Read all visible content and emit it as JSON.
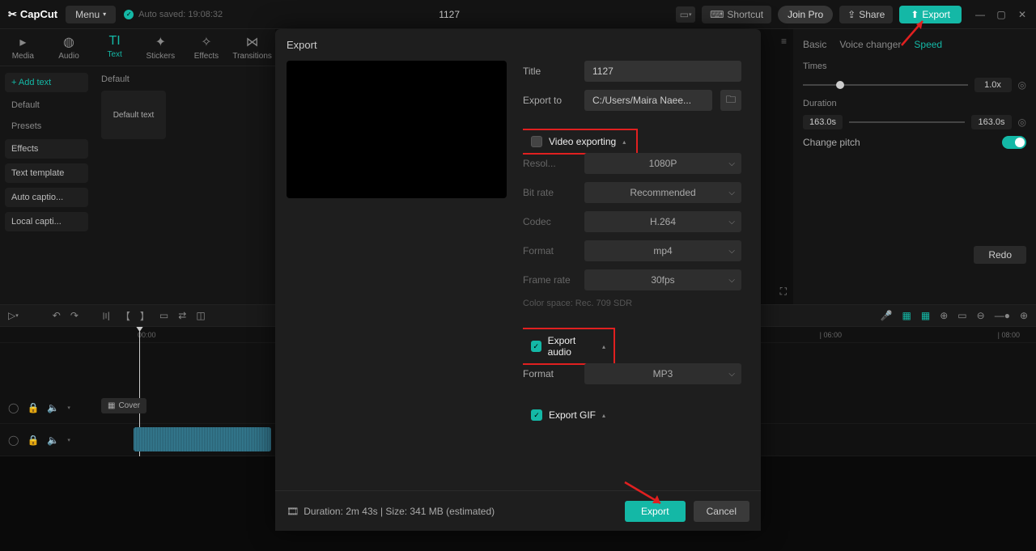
{
  "app": {
    "name": "CapCut"
  },
  "topbar": {
    "menu": "Menu",
    "autosave": "Auto saved: 19:08:32",
    "title": "1127",
    "shortcut": "Shortcut",
    "joinpro": "Join Pro",
    "share": "Share",
    "export": "Export"
  },
  "tabs": {
    "media": "Media",
    "audio": "Audio",
    "text": "Text",
    "stickers": "Stickers",
    "effects": "Effects",
    "transitions": "Transitions"
  },
  "sidebar": {
    "add_text": "+ Add text",
    "default": "Default",
    "presets": "Presets",
    "effects": "Effects",
    "text_template": "Text template",
    "auto_captions": "Auto captio...",
    "local_captions": "Local capti..."
  },
  "left_content": {
    "section": "Default",
    "tile": "Default text"
  },
  "right": {
    "tabs": {
      "basic": "Basic",
      "voice": "Voice changer",
      "speed": "Speed"
    },
    "times": "Times",
    "times_val": "1.0x",
    "duration": "Duration",
    "dur_from": "163.0s",
    "dur_to": "163.0s",
    "change_pitch": "Change pitch",
    "redo": "Redo"
  },
  "timeline": {
    "start": "00:00",
    "t6": "| 06:00",
    "t8": "| 08:00",
    "cover": "Cover"
  },
  "modal": {
    "header": "Export",
    "title_label": "Title",
    "title_value": "1127",
    "exportto_label": "Export to",
    "exportto_value": "C:/Users/Maira Naee...",
    "video_section": "Video exporting",
    "resolution_label": "Resol...",
    "resolution_value": "1080P",
    "bitrate_label": "Bit rate",
    "bitrate_value": "Recommended",
    "codec_label": "Codec",
    "codec_value": "H.264",
    "format_label": "Format",
    "format_value": "mp4",
    "framerate_label": "Frame rate",
    "framerate_value": "30fps",
    "colorspace": "Color space: Rec. 709 SDR",
    "audio_section": "Export audio",
    "audio_format_label": "Format",
    "audio_format_value": "MP3",
    "gif_section": "Export GIF",
    "footer_info": "Duration: 2m 43s | Size: 341 MB (estimated)",
    "export_btn": "Export",
    "cancel_btn": "Cancel"
  }
}
